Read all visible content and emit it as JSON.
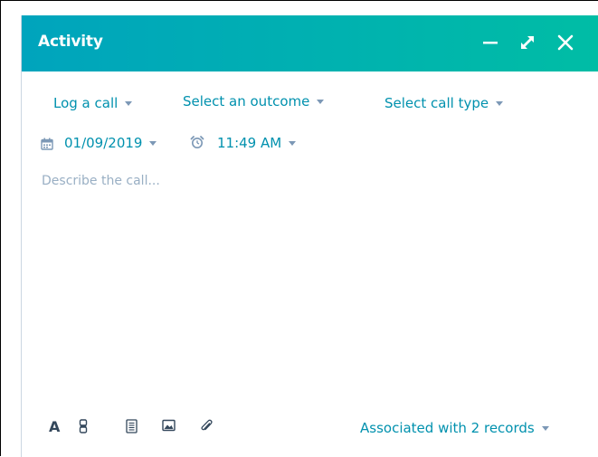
{
  "header": {
    "title": "Activity",
    "minimize_icon": "minimize-icon",
    "expand_icon": "expand-icon",
    "close_icon": "close-icon"
  },
  "call_options": {
    "log_call": "Log a call",
    "outcome": "Select an outcome",
    "call_type": "Select call type"
  },
  "datetime": {
    "date": "01/09/2019",
    "time": "11:49 AM"
  },
  "description": {
    "placeholder": "Describe the call..."
  },
  "toolbar": {
    "text_format_label": "A"
  },
  "association": {
    "label": "Associated with 2 records"
  },
  "colors": {
    "header_start": "#00a4bd",
    "header_end": "#00bda5",
    "link": "#0091ae",
    "placeholder": "#99afc4"
  }
}
